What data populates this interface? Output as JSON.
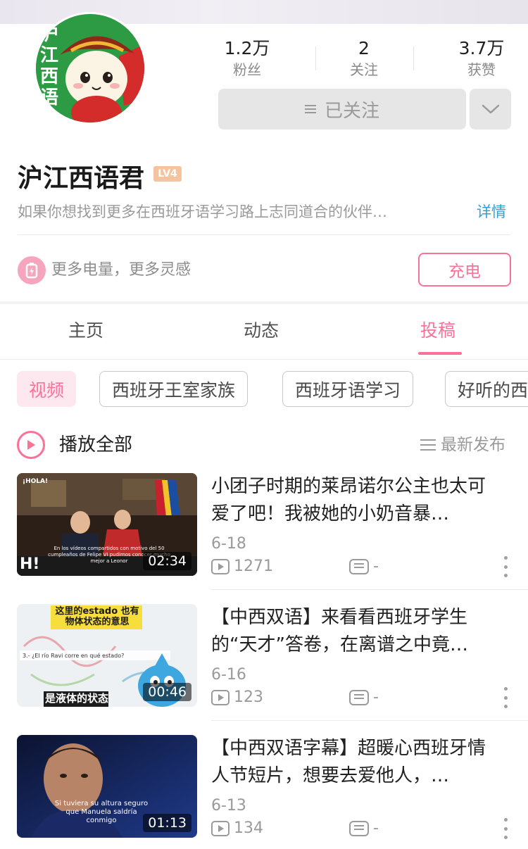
{
  "profile": {
    "name": "沪江西语君",
    "level_badge": "LV4",
    "bio": "如果你想找到更多在西班牙语学习路上志同道合的伙伴…",
    "detail_link": "详情",
    "avatar_text": "沪江西语"
  },
  "stats": [
    {
      "value": "1.2万",
      "label": "粉丝"
    },
    {
      "value": "2",
      "label": "关注"
    },
    {
      "value": "3.7万",
      "label": "获赞"
    }
  ],
  "follow_button": "已关注",
  "charge": {
    "text": "更多电量，更多灵感",
    "button": "充电"
  },
  "tabs": [
    {
      "label": "主页",
      "active": false
    },
    {
      "label": "动态",
      "active": false
    },
    {
      "label": "投稿",
      "active": true
    }
  ],
  "chips": [
    {
      "label": "视频",
      "active": true
    },
    {
      "label": "西班牙王室家族",
      "active": false
    },
    {
      "label": "西班牙语学习",
      "active": false
    },
    {
      "label": "好听的西",
      "active": false
    }
  ],
  "play_all": "播放全部",
  "sort_label": "最新发布",
  "videos": [
    {
      "title": "小团子时期的莱昂诺尔公主也太可爱了吧！我被她的小奶音暴…",
      "date": "6-18",
      "plays": "1271",
      "danmaku": "-",
      "duration": "02:34",
      "thumb_caption": "En los vídeos compartidos con motivo del 50 cumpleaños de Felipe VI pudimos conocer mucho mejor a Leonor"
    },
    {
      "title": "【中西双语】来看看西班牙学生的“天才”答卷，在离谱之中竟…",
      "date": "6-16",
      "plays": "123",
      "danmaku": "-",
      "duration": "00:46",
      "thumb_caption": "是液体的状态",
      "thumb_top": "这里的estado 也有物体状态的意思"
    },
    {
      "title": "【中西双语字幕】超暖心西班牙情人节短片，想要去爱他人，…",
      "date": "6-13",
      "plays": "134",
      "danmaku": "-",
      "duration": "01:13",
      "thumb_caption": "Si tuviera su altura seguro que Manuela saldría conmigo"
    }
  ],
  "colors": {
    "accent": "#fb7299",
    "link": "#2f9fd6",
    "muted": "#9a9a9a"
  }
}
